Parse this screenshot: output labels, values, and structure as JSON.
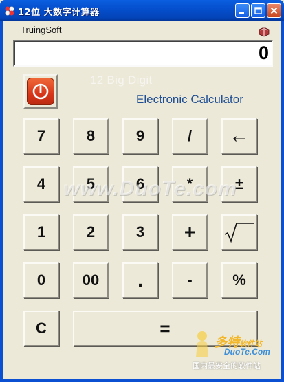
{
  "window": {
    "title": "12位 大数字计算器",
    "controls": [
      "minimize-icon",
      "maximize-icon",
      "close-icon"
    ]
  },
  "brand": "TruingSoft",
  "help_icon": "book-icon",
  "display": {
    "value": "0"
  },
  "power_icon": "power-icon",
  "subtitle": {
    "line1": "12 Big Digit",
    "line2": "Electronic Calculator"
  },
  "keys": {
    "k7": "7",
    "k8": "8",
    "k9": "9",
    "div": "/",
    "back": "←",
    "k4": "4",
    "k5": "5",
    "k6": "6",
    "mul": "*",
    "sign": "±",
    "k1": "1",
    "k2": "2",
    "k3": "3",
    "add": "+",
    "sqrt": "√",
    "k0": "0",
    "k00": "00",
    "dot": ".",
    "sub": "-",
    "pct": "%",
    "clear": "C",
    "eq": "="
  },
  "watermarks": {
    "duote": "www.DuoTe.com",
    "logo_main": "多特",
    "logo_sub": "软件站",
    "logo_url": "DuoTe.Com",
    "logo_slogan": "国内最安全的软件站"
  },
  "colors": {
    "titlebar": "#0550cf",
    "subtitle2": "#1f4e93",
    "window_bg": "#ece9d8",
    "power": "#d8361a"
  }
}
